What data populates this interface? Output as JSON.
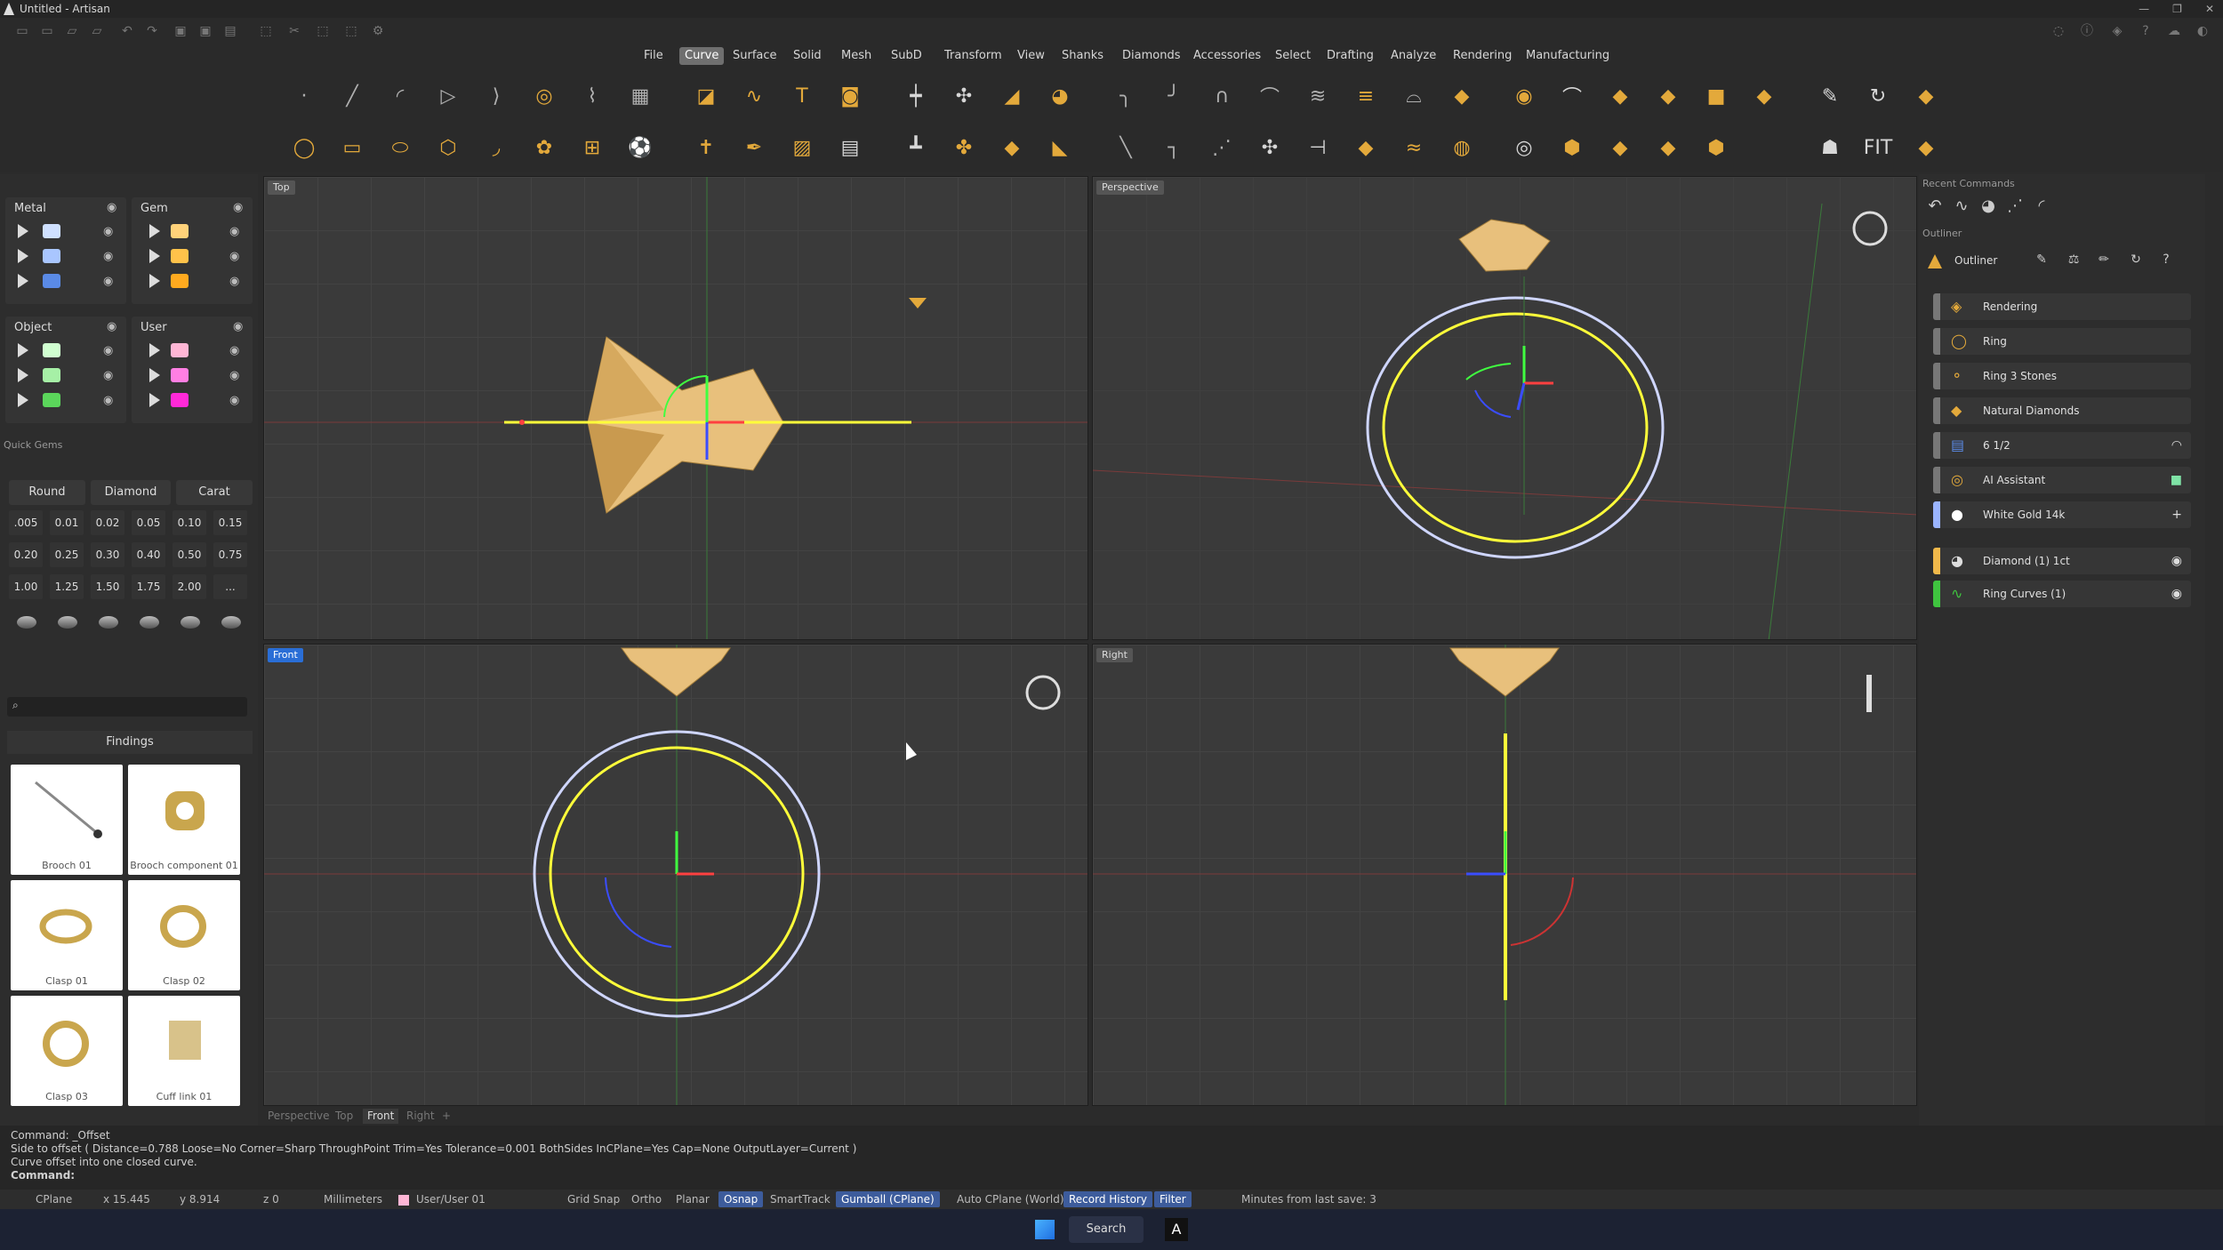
{
  "window": {
    "title": "Untitled - Artisan",
    "buttons": [
      "—",
      "❐",
      "✕"
    ]
  },
  "menu": [
    "File",
    "Curve",
    "Surface",
    "Solid",
    "Mesh",
    "SubD",
    "Transform",
    "View",
    "Shanks",
    "Diamonds",
    "Accessories",
    "Select",
    "Drafting",
    "Analyze",
    "Rendering",
    "Manufacturing"
  ],
  "menu_active": "Curve",
  "layers": {
    "metal": {
      "label": "Metal",
      "colors": [
        "#cfe0ff",
        "#a9c6ff",
        "#5a8ae6"
      ]
    },
    "gem": {
      "label": "Gem",
      "colors": [
        "#ffd27a",
        "#ffc24a",
        "#ffaa1f"
      ]
    },
    "object": {
      "label": "Object",
      "colors": [
        "#d0ffd0",
        "#a6f0a6",
        "#5bd65b"
      ]
    },
    "user": {
      "label": "User",
      "colors": [
        "#ffb6d5",
        "#ff7fe3",
        "#ff29d8"
      ]
    }
  },
  "quick_gems": {
    "title": "Quick Gems",
    "shape": "Round",
    "type": "Diamond",
    "unit": "Carat",
    "values": [
      ".005",
      "0.01",
      "0.02",
      "0.05",
      "0.10",
      "0.15",
      "0.20",
      "0.25",
      "0.30",
      "0.40",
      "0.50",
      "0.75",
      "1.00",
      "1.25",
      "1.50",
      "1.75",
      "2.00",
      "..."
    ]
  },
  "findings": {
    "category": "Findings",
    "search_placeholder": "",
    "items": [
      "Brooch 01",
      "Brooch component 01",
      "Clasp 01",
      "Clasp 02",
      "Clasp 03",
      "Cuff link 01"
    ]
  },
  "viewports": {
    "top": "Top",
    "perspective": "Perspective",
    "front": "Front",
    "right": "Right"
  },
  "viewport_tabs": [
    "Perspective",
    "Top",
    "Front",
    "Right",
    "+"
  ],
  "viewport_tab_active": "Front",
  "right_panel": {
    "recent_commands": "Recent Commands",
    "outliner_section": "Outliner",
    "outliner_title": "Outliner",
    "rows": [
      {
        "label": "Rendering",
        "color": "#777777"
      },
      {
        "label": "Ring",
        "color": "#777777"
      },
      {
        "label": "Ring 3 Stones",
        "color": "#777777"
      },
      {
        "label": "Natural Diamonds",
        "color": "#777777"
      },
      {
        "label": "6 1/2",
        "color": "#777777"
      },
      {
        "label": "AI Assistant",
        "color": "#777777"
      },
      {
        "label": "White Gold 14k",
        "color": "#9ab4ff"
      },
      {
        "label": "Diamond (1) 1ct",
        "color": "#f0b84a"
      },
      {
        "label": "Ring Curves (1)",
        "color": "#3fc43f"
      }
    ]
  },
  "command": {
    "lines": [
      "Command: _Offset",
      "Side to offset ( Distance=0.788  Loose=No  Corner=Sharp  ThroughPoint  Trim=Yes  Tolerance=0.001  BothSides  InCPlane=Yes  Cap=None  OutputLayer=Current )",
      "Curve offset into one closed curve."
    ],
    "prompt": "Command:"
  },
  "status": {
    "cplane": "CPlane",
    "x": "x 15.445",
    "y": "y 8.914",
    "z": "z 0",
    "units": "Millimeters",
    "layer": "User/User 01",
    "grid_snap": "Grid Snap",
    "ortho": "Ortho",
    "planar": "Planar",
    "osnap": "Osnap",
    "smarttrack": "SmartTrack",
    "gumball": "Gumball (CPlane)",
    "autocplane": "Auto CPlane (World)",
    "record_history": "Record History",
    "filter": "Filter",
    "last_save": "Minutes from last save: 3"
  },
  "taskbar": {
    "search": "Search"
  }
}
